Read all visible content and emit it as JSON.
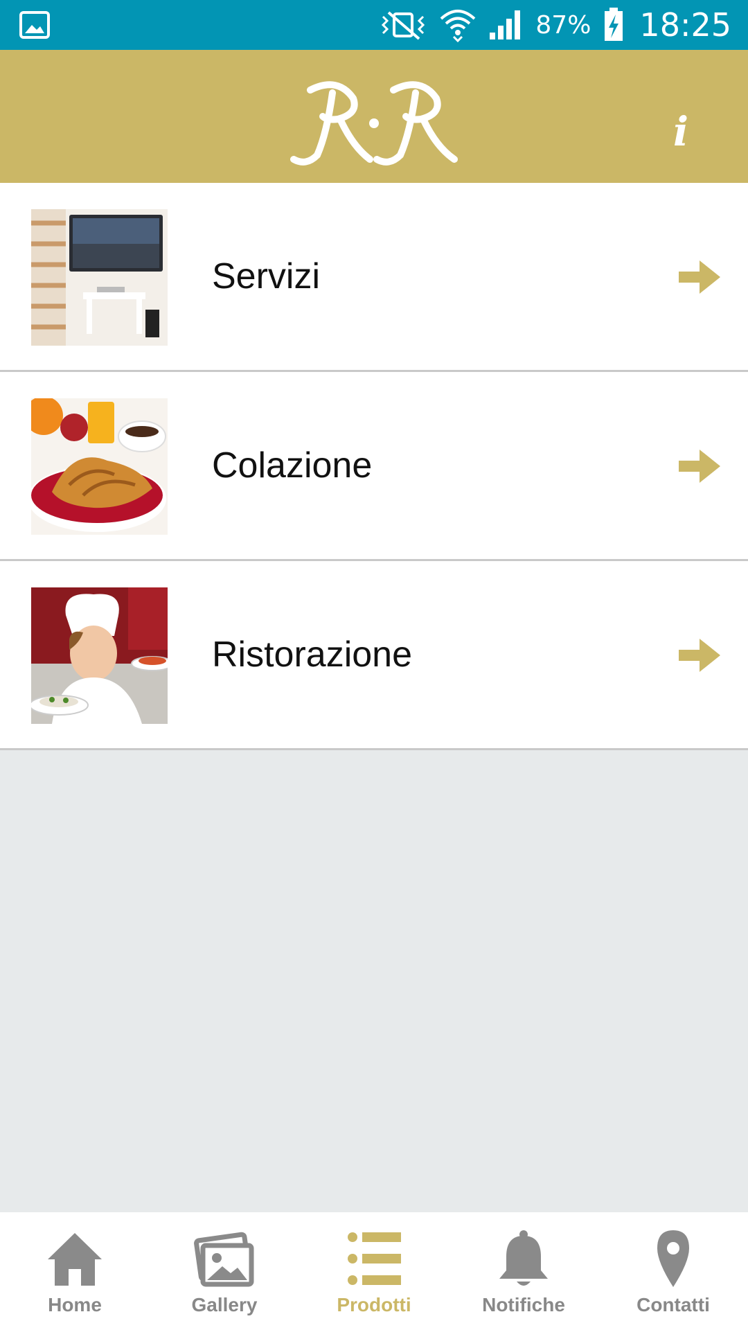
{
  "status_bar": {
    "battery": "87%",
    "time": "18:25",
    "icons": [
      "gallery-icon",
      "vibrate-icon",
      "wifi-icon",
      "signal-icon",
      "battery-charging-icon"
    ]
  },
  "header": {
    "logo": "RR",
    "info_label": "i"
  },
  "colors": {
    "status_bar": "#0295b4",
    "header": "#cbb766",
    "accent": "#cbb766",
    "nav_inactive": "#888888",
    "background": "#e7eaeb"
  },
  "list": {
    "items": [
      {
        "label": "Servizi",
        "thumb": "tv-room-photo"
      },
      {
        "label": "Colazione",
        "thumb": "croissant-breakfast-photo"
      },
      {
        "label": "Ristorazione",
        "thumb": "chef-photo"
      }
    ]
  },
  "bottom_nav": {
    "items": [
      {
        "label": "Home",
        "icon": "home-icon"
      },
      {
        "label": "Gallery",
        "icon": "image-icon"
      },
      {
        "label": "Prodotti",
        "icon": "list-icon",
        "active": true
      },
      {
        "label": "Notifiche",
        "icon": "bell-icon"
      },
      {
        "label": "Contatti",
        "icon": "location-pin-icon"
      }
    ]
  }
}
